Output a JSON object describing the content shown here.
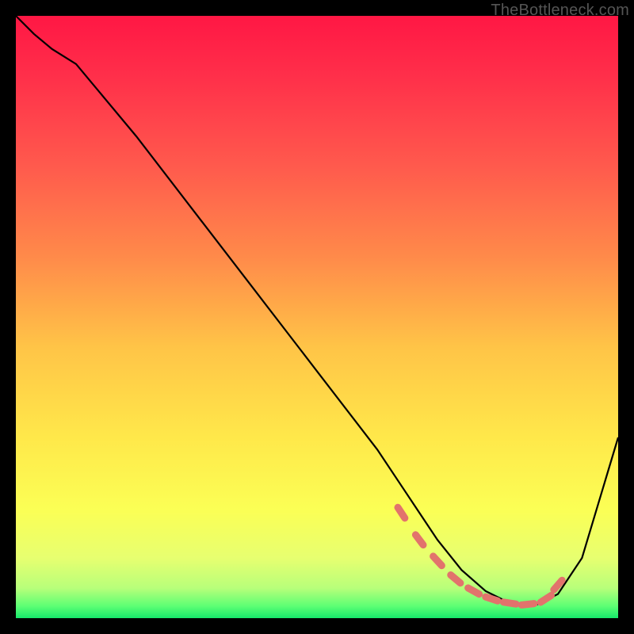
{
  "watermark": "TheBottleneck.com",
  "chart_data": {
    "type": "line",
    "title": "",
    "xlabel": "",
    "ylabel": "",
    "xlim": [
      0,
      100
    ],
    "ylim": [
      0,
      100
    ],
    "grid": false,
    "legend": false,
    "gradient_stops": [
      {
        "offset": 0.0,
        "color": "#ff1744"
      },
      {
        "offset": 0.1,
        "color": "#ff2f4a"
      },
      {
        "offset": 0.25,
        "color": "#ff5a4d"
      },
      {
        "offset": 0.4,
        "color": "#ff8a4a"
      },
      {
        "offset": 0.55,
        "color": "#ffc447"
      },
      {
        "offset": 0.7,
        "color": "#ffe84a"
      },
      {
        "offset": 0.82,
        "color": "#fbff55"
      },
      {
        "offset": 0.9,
        "color": "#e7ff70"
      },
      {
        "offset": 0.95,
        "color": "#b8ff7a"
      },
      {
        "offset": 0.98,
        "color": "#5dff74"
      },
      {
        "offset": 1.0,
        "color": "#17e86b"
      }
    ],
    "series": [
      {
        "name": "curve",
        "color": "#000000",
        "width": 2.2,
        "x": [
          0,
          3,
          6,
          10,
          20,
          30,
          40,
          50,
          60,
          66,
          70,
          74,
          78,
          82,
          86,
          90,
          94,
          100
        ],
        "y": [
          100,
          97,
          94.5,
          92,
          80,
          67,
          54,
          41,
          28,
          19,
          13,
          8,
          4.5,
          2.5,
          2,
          4,
          10,
          30
        ]
      },
      {
        "name": "optimal-band",
        "type": "dashed-dots",
        "color": "#e2736c",
        "marker_size": 9,
        "x": [
          64,
          67,
          70,
          73,
          76,
          79,
          82,
          85,
          88,
          90
        ],
        "y": [
          17.5,
          13,
          9.5,
          6.5,
          4.5,
          3.2,
          2.5,
          2.3,
          3.2,
          5.5
        ]
      }
    ]
  }
}
